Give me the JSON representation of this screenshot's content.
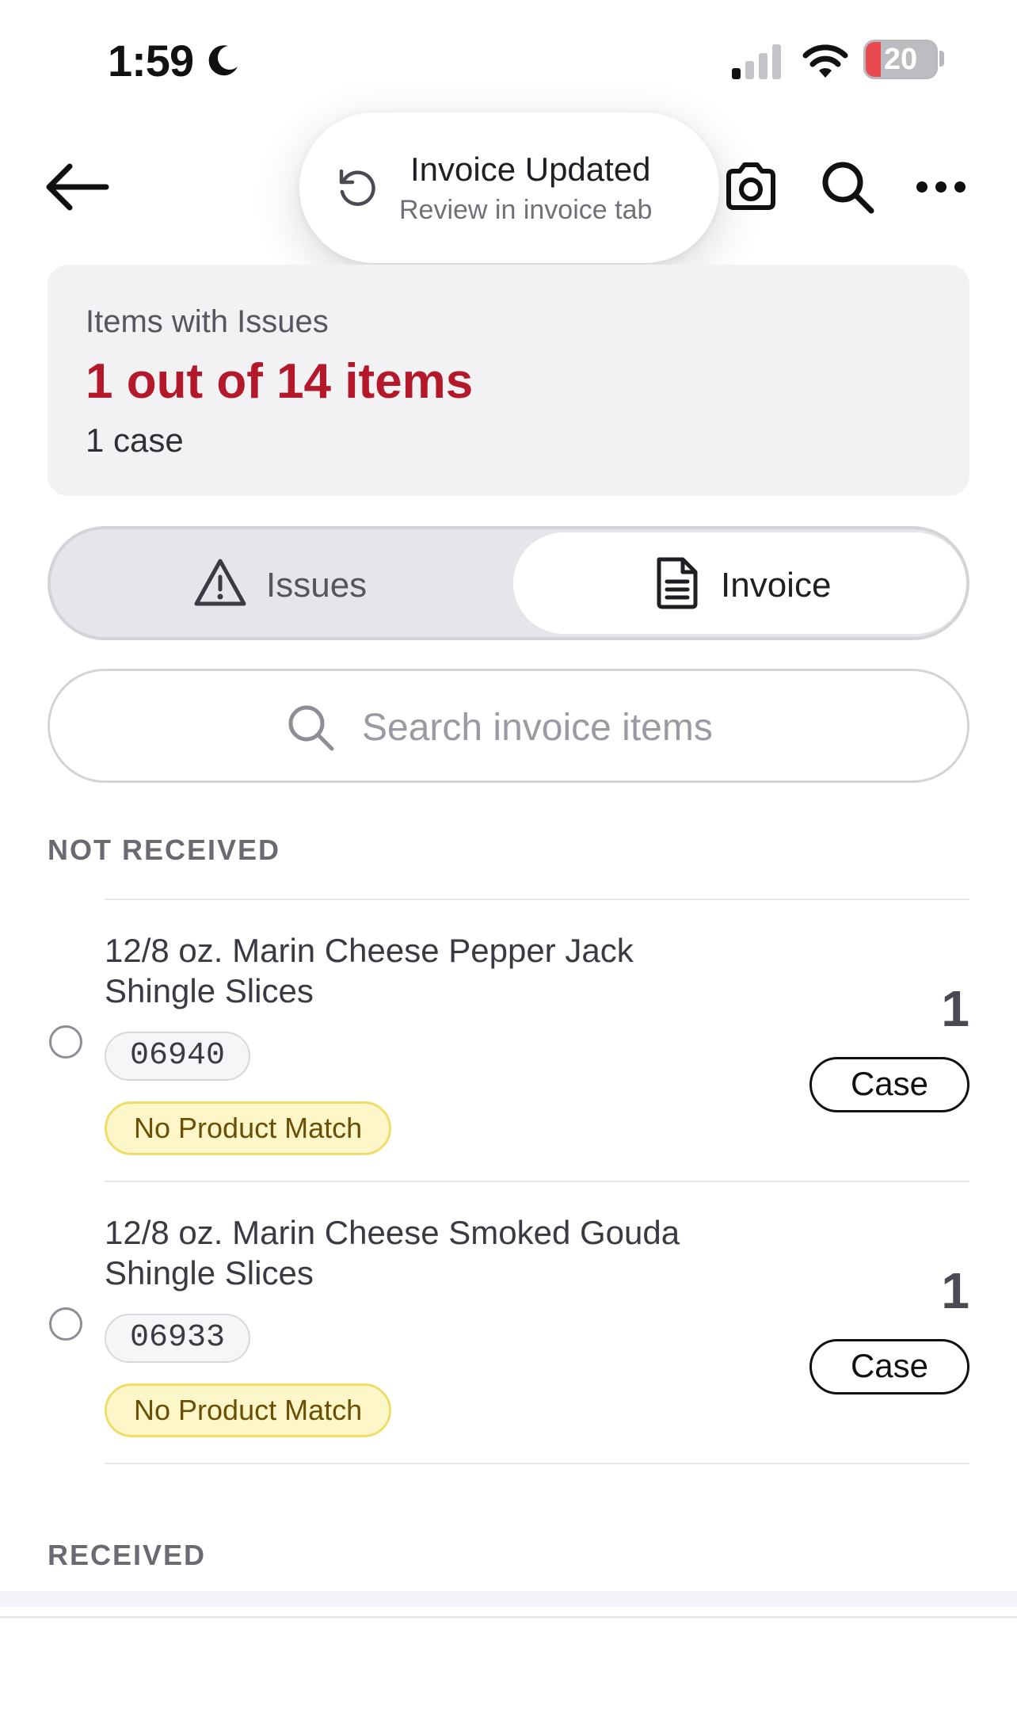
{
  "status_bar": {
    "time": "1:59",
    "battery": "20"
  },
  "toast": {
    "title": "Invoice Updated",
    "subtitle": "Review in invoice tab"
  },
  "summary": {
    "label": "Items with Issues",
    "count_text": "1 out of 14 items",
    "cases_text": "1 case"
  },
  "tabs": [
    {
      "label": "Issues",
      "icon": "warning-icon",
      "selected": false
    },
    {
      "label": "Invoice",
      "icon": "document-icon",
      "selected": true
    }
  ],
  "search": {
    "placeholder": "Search invoice items",
    "value": ""
  },
  "sections": {
    "not_received": {
      "title": "NOT RECEIVED",
      "items": [
        {
          "name": "12/8 oz. Marin Cheese Pepper Jack Shingle Slices",
          "sku": "06940",
          "badge": "No Product Match",
          "quantity": "1",
          "unit": "Case"
        },
        {
          "name": "12/8 oz. Marin Cheese Smoked Gouda Shingle Slices",
          "sku": "06933",
          "badge": "No Product Match",
          "quantity": "1",
          "unit": "Case"
        }
      ]
    },
    "received": {
      "title": "RECEIVED"
    }
  },
  "colors": {
    "issue_red": "#b3182b",
    "badge_bg": "#fdf6c9",
    "badge_border": "#efdd6a",
    "badge_text": "#6b4f05"
  }
}
